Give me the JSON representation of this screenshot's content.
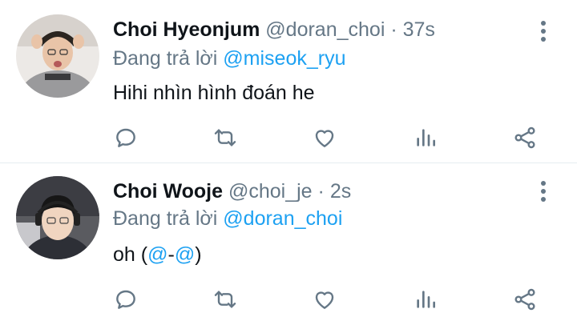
{
  "tweets": [
    {
      "name": "Choi Hyeonjum",
      "handle": "@doran_choi",
      "separator": "·",
      "time": "37s",
      "reply_prefix": "Đang trả lời",
      "reply_to": "@miseok_ryu",
      "text": "Hihi nhìn hình đoán he"
    },
    {
      "name": "Choi Wooje",
      "handle": "@choi_je",
      "separator": "·",
      "time": "2s",
      "reply_prefix": "Đang trả lời",
      "reply_to": "@doran_choi",
      "text_prefix": "oh (",
      "text_mention_1": "@",
      "text_dash": "-",
      "text_mention_2": "@",
      "text_suffix": ")"
    }
  ],
  "actions": [
    "reply-icon",
    "retweet-icon",
    "like-icon",
    "analytics-icon",
    "share-icon"
  ],
  "colors": {
    "accent": "#1da1f2",
    "muted": "#657786",
    "text": "#0f1419",
    "divider": "#e6ecf0"
  }
}
